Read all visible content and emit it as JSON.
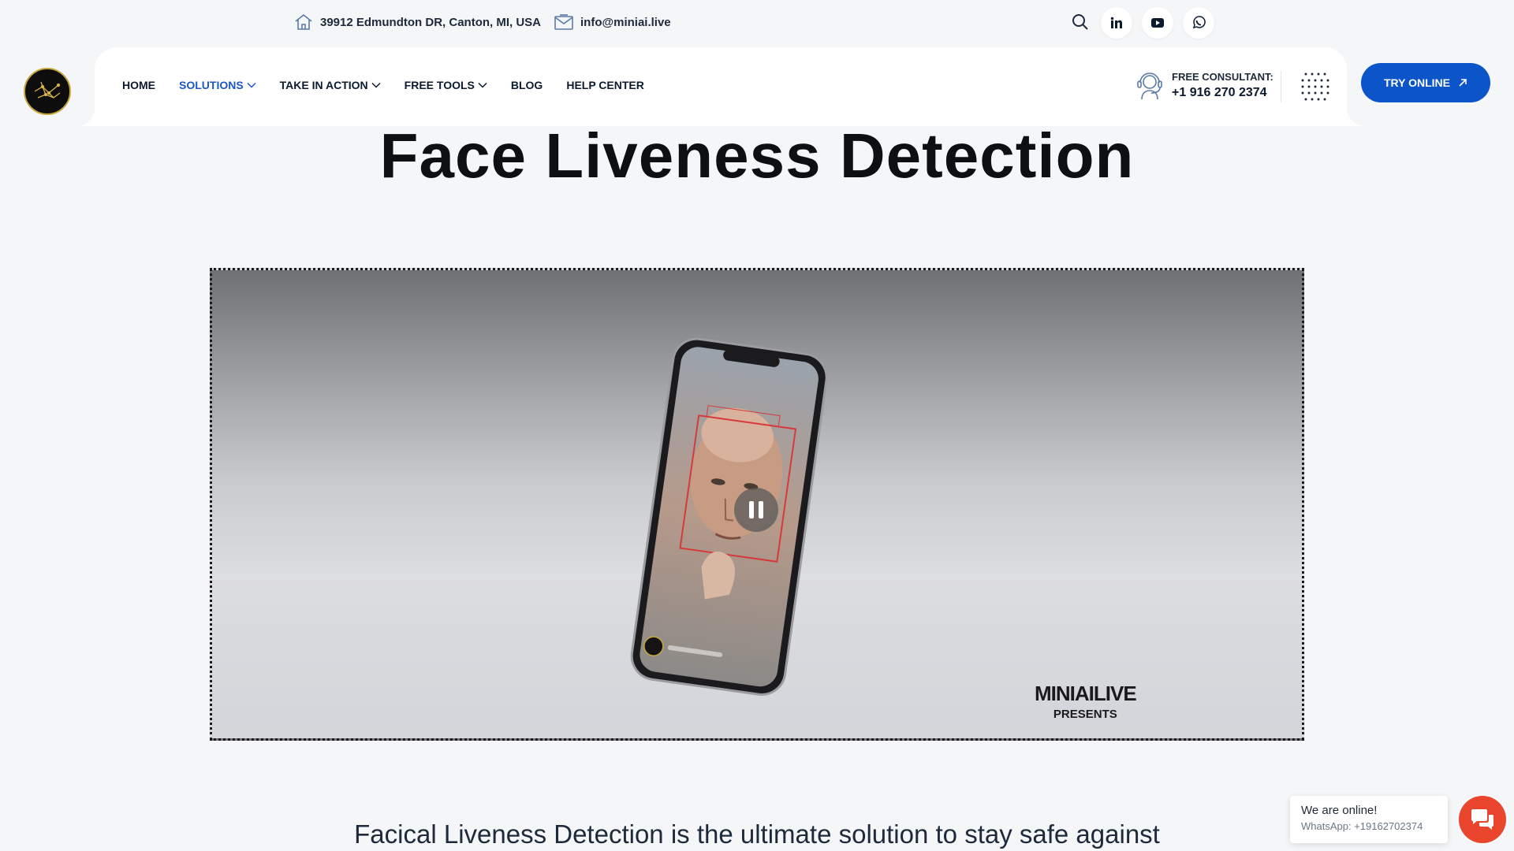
{
  "topbar": {
    "address": "39912 Edmundton DR, Canton, MI, USA",
    "address_icon": "home-icon",
    "email": "info@miniai.live",
    "email_icon": "mail-icon",
    "social": [
      "linkedin-icon",
      "youtube-icon",
      "whatsapp-icon"
    ]
  },
  "nav": {
    "items": [
      {
        "label": "HOME",
        "dropdown": false
      },
      {
        "label": "SOLUTIONS",
        "dropdown": true,
        "active": true
      },
      {
        "label": "TAKE IN ACTION",
        "dropdown": true
      },
      {
        "label": "FREE TOOLS",
        "dropdown": true
      },
      {
        "label": "BLOG",
        "dropdown": false
      },
      {
        "label": "HELP CENTER",
        "dropdown": false
      }
    ],
    "consult_label": "FREE CONSULTANT:",
    "consult_phone": "+1 916 270 2374",
    "cta_label": "TRY ONLINE"
  },
  "hero": {
    "title": "Face Liveness Detection"
  },
  "video": {
    "brand_line1": "MINIAILIVE",
    "brand_line2": "PRESENTS",
    "state": "playing"
  },
  "description": {
    "text": "Facical Liveness Detection is the ultimate solution to stay safe against"
  },
  "chat": {
    "status": "We are online!",
    "whatsapp": "WhatsApp: +19162702374"
  },
  "colors": {
    "accent": "#0b55c9",
    "active_nav": "#1b57c8",
    "chat": "#e8452c",
    "background": "#f4f6f8"
  }
}
